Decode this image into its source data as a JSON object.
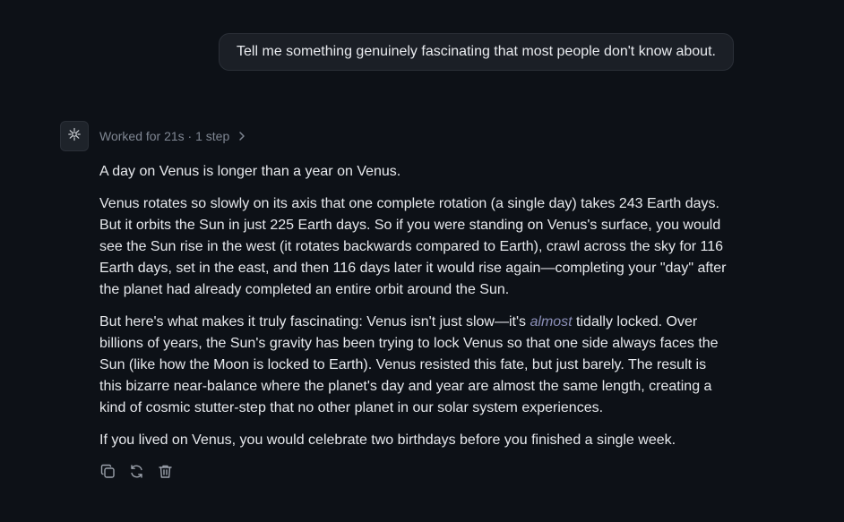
{
  "user_message": {
    "text": "Tell me something genuinely fascinating that most people don't know about."
  },
  "assistant": {
    "avatar_icon": "bot-icon",
    "status": "Worked for 21s · 1 step",
    "expand_icon": "chevron-right-icon",
    "paragraphs": {
      "p1": "A day on Venus is longer than a year on Venus.",
      "p2": "Venus rotates so slowly on its axis that one complete rotation (a single day) takes 243 Earth days. But it orbits the Sun in just 225 Earth days. So if you were standing on Venus's surface, you would see the Sun rise in the west (it rotates backwards compared to Earth), crawl across the sky for 116 Earth days, set in the east, and then 116 days later it would rise again—completing your \"day\" after the planet had already completed an entire orbit around the Sun.",
      "p3_before": "But here's what makes it truly fascinating: Venus isn't just slow—it's ",
      "p3_em": "almost",
      "p3_after": " tidally locked. Over billions of years, the Sun's gravity has been trying to lock Venus so that one side always faces the Sun (like how the Moon is locked to Earth). Venus resisted this fate, but just barely. The result is this bizarre near-balance where the planet's day and year are almost the same length, creating a kind of cosmic stutter-step that no other planet in our solar system experiences.",
      "p4": "If you lived on Venus, you would celebrate two birthdays before you finished a single week."
    },
    "actions": [
      {
        "icon": "copy-icon"
      },
      {
        "icon": "regenerate-icon"
      },
      {
        "icon": "trash-icon"
      }
    ]
  },
  "colors": {
    "background": "#0d1117",
    "bubble": "#1b1f26",
    "text": "#e6e8ec",
    "muted": "#7f8692",
    "emphasis": "#8b8fb8"
  }
}
